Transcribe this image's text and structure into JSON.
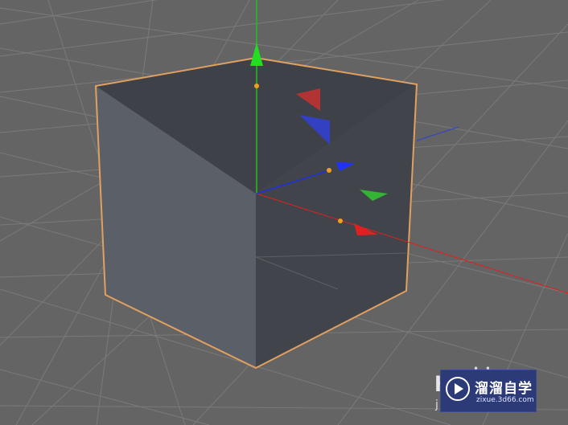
{
  "viewport": {
    "background": "#646464",
    "grid_color": "#7a7a7a",
    "cube_outline_color": "#e0a060",
    "axis_colors": {
      "x": "#e02020",
      "y": "#20c020",
      "z": "#2030e0"
    }
  },
  "watermark": {
    "title": "溜溜自学",
    "url": "zixue.3d66.com",
    "left_char": "h",
    "left_sub": "j",
    "dots": "• •",
    "icon": "play-icon"
  }
}
